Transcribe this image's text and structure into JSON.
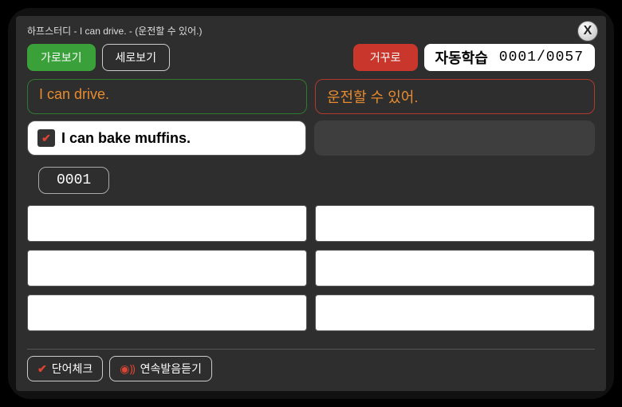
{
  "window": {
    "title": "하프스터디 - I can drive. - (운전할 수 있어.)"
  },
  "toolbar": {
    "horizontal_view": "가로보기",
    "vertical_view": "세로보기",
    "reverse": "거꾸로",
    "auto_learn_label": "자동학습",
    "counter": "0001/0057"
  },
  "headers": {
    "english": "I can drive.",
    "korean": "운전할 수 있어."
  },
  "current": {
    "sentence": "I can bake muffins.",
    "number": "0001"
  },
  "footer": {
    "word_check": "단어체크",
    "continuous_audio": "연속발음듣기"
  },
  "icons": {
    "close": "X",
    "check": "✔",
    "sound": "◉⸩"
  }
}
